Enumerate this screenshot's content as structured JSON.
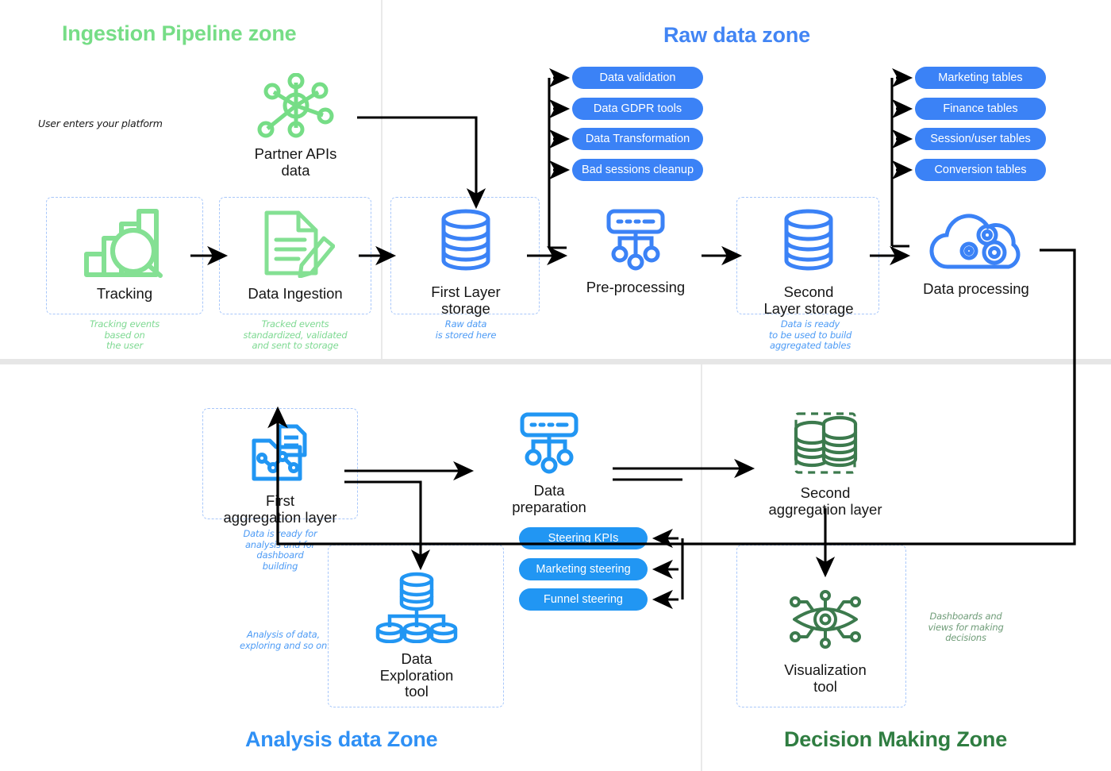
{
  "zones": [
    {
      "id": "ingestion",
      "title": "Ingestion Pipeline zone",
      "color": "#76dd86"
    },
    {
      "id": "raw",
      "title": "Raw data zone",
      "color": "#4285f4"
    },
    {
      "id": "analysis",
      "title": "Analysis data Zone",
      "color": "#2f90f5"
    },
    {
      "id": "decision",
      "title": "Decision Making Zone",
      "color": "#2f7d41"
    }
  ],
  "notes": {
    "user_enters": "User enters your platform"
  },
  "nodes": {
    "partner_apis": {
      "label": "Partner APIs\ndata",
      "icon": "network-nodes-icon",
      "color": "#76dd86"
    },
    "tracking": {
      "label": "Tracking",
      "icon": "bar-chart-magnifier-icon",
      "color": "#76dd86",
      "caption": "Tracking events\nbased on\nthe user"
    },
    "data_ingestion": {
      "label": "Data Ingestion",
      "icon": "document-pencil-icon",
      "color": "#76dd86",
      "caption": "Tracked events\nstandardized, validated\nand sent to storage"
    },
    "first_layer_storage": {
      "label": "First Layer\nstorage",
      "icon": "database-stack-icon",
      "color": "#3b82f6",
      "caption": "Raw data\nis stored here"
    },
    "pre_processing": {
      "label": "Pre-processing",
      "icon": "server-tree-icon",
      "color": "#3b82f6"
    },
    "second_layer_storage": {
      "label": "Second\nLayer storage",
      "icon": "database-stack-icon",
      "color": "#3b82f6",
      "caption": "Data is ready\nto be used to build\naggregated tables"
    },
    "data_processing": {
      "label": "Data processing",
      "icon": "cloud-gears-icon",
      "color": "#3b82f6"
    },
    "first_aggregation_layer": {
      "label": "First\naggregation layer",
      "icon": "folder-analytics-icon",
      "color": "#3b82f6",
      "caption": "Data is ready for\nanalysis and for\ndashboard\nbuilding"
    },
    "data_preparation": {
      "label": "Data\npreparation",
      "icon": "server-tree-icon",
      "color": "#3b82f6"
    },
    "data_exploration_tool": {
      "label": "Data\nExploration\ntool",
      "icon": "database-hierarchy-icon",
      "color": "#3b82f6",
      "caption": "Analysis of data,\nexploring and so on"
    },
    "second_aggregation_layer": {
      "label": "Second\naggregation layer",
      "icon": "double-database-dashed-icon",
      "color": "#3c7a4d"
    },
    "visualization_tool": {
      "label": "Visualization\ntool",
      "icon": "eye-circuit-icon",
      "color": "#3c7a4d",
      "caption": "Dashboards and\nviews for making\ndecisions"
    }
  },
  "pill_groups": {
    "pre_processing_steps": {
      "items": [
        "Data validation",
        "Data GDPR tools",
        "Data Transformation",
        "Bad sessions cleanup"
      ],
      "color": "#3b82f6"
    },
    "processed_tables": {
      "items": [
        "Marketing tables",
        "Finance tables",
        "Session/user tables",
        "Conversion tables"
      ],
      "color": "#3b82f6"
    },
    "steering_outputs": {
      "items": [
        "Steering KPIs",
        "Marketing steering",
        "Funnel steering"
      ],
      "color": "#2196f3"
    }
  },
  "colors": {
    "green_light": "#76dd86",
    "blue": "#3b82f6",
    "blue_light": "#2f90f5",
    "green_dark": "#2f7d41",
    "arrow": "#000000",
    "dashed_box": "#a8c7fa"
  }
}
